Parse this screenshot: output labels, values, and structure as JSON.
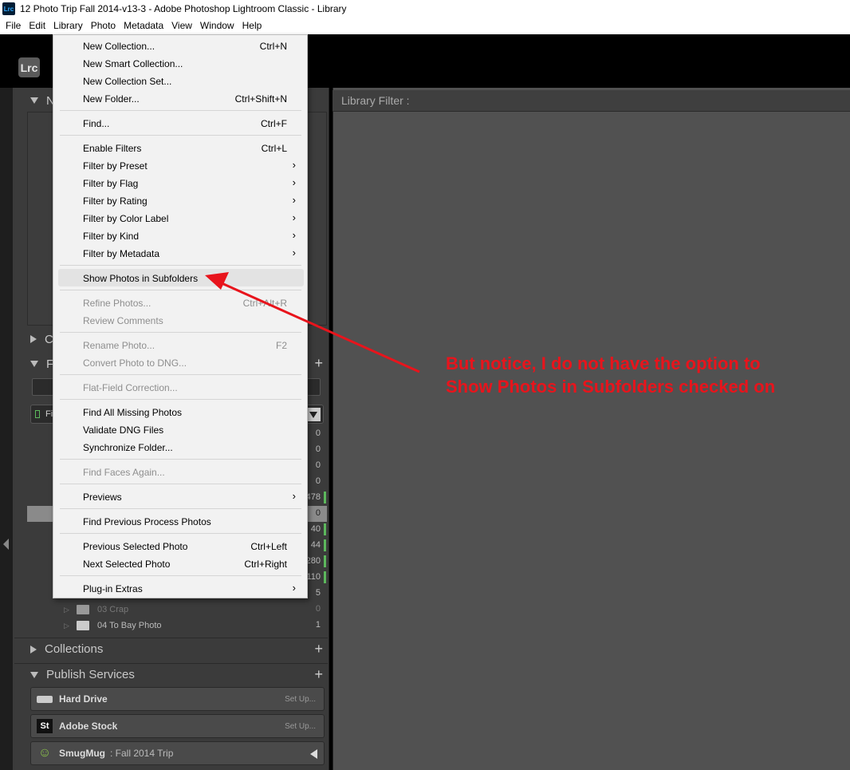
{
  "window": {
    "title": "12 Photo Trip Fall 2014-v13-3 - Adobe Photoshop Lightroom Classic - Library",
    "app_icon": "Lrc"
  },
  "menubar": [
    "File",
    "Edit",
    "Library",
    "Photo",
    "Metadata",
    "View",
    "Window",
    "Help"
  ],
  "logo": "Lrc",
  "left_panel": {
    "navigator_initial": "N",
    "collapsed_initial_c": "C",
    "folders_initial": "F",
    "volume_initial": "Fi",
    "folder_counts": [
      "0",
      "0",
      "0",
      "0",
      "478",
      "0",
      "40",
      "44",
      "280",
      "110",
      "5"
    ],
    "folder_rows": [
      {
        "name": "03 Crap",
        "count": "0",
        "dim": true
      },
      {
        "name": "04 To Bay Photo",
        "count": "1",
        "dim": false
      }
    ],
    "collections_label": "Collections",
    "publish_label": "Publish Services",
    "publish_services": [
      {
        "name": "Hard Drive",
        "sub": "",
        "action": "Set Up...",
        "icon": "hard-drive-icon"
      },
      {
        "name": "Adobe Stock",
        "sub": "",
        "action": "Set Up...",
        "icon": "adobe-stock-icon",
        "icon_text": "St"
      },
      {
        "name": "SmugMug",
        "sub": ":  Fall 2014 Trip",
        "action": "",
        "icon": "smugmug-icon"
      }
    ]
  },
  "library_filter": "Library Filter :",
  "library_menu": {
    "items": [
      {
        "label": "New Collection...",
        "shortcut": "Ctrl+N"
      },
      {
        "label": "New Smart Collection...",
        "shortcut": ""
      },
      {
        "label": "New Collection Set...",
        "shortcut": ""
      },
      {
        "label": "New Folder...",
        "shortcut": "Ctrl+Shift+N"
      },
      {
        "label": "Find...",
        "shortcut": "Ctrl+F"
      },
      {
        "label": "Enable Filters",
        "shortcut": "Ctrl+L"
      },
      {
        "label": "Filter by Preset",
        "shortcut": ""
      },
      {
        "label": "Filter by Flag",
        "shortcut": ""
      },
      {
        "label": "Filter by Rating",
        "shortcut": ""
      },
      {
        "label": "Filter by Color Label",
        "shortcut": ""
      },
      {
        "label": "Filter by Kind",
        "shortcut": ""
      },
      {
        "label": "Filter by Metadata",
        "shortcut": ""
      },
      {
        "label": "Show Photos in Subfolders",
        "shortcut": ""
      },
      {
        "label": "Refine Photos...",
        "shortcut": "Ctrl+Alt+R"
      },
      {
        "label": "Review Comments",
        "shortcut": ""
      },
      {
        "label": "Rename Photo...",
        "shortcut": "F2"
      },
      {
        "label": "Convert Photo to DNG...",
        "shortcut": ""
      },
      {
        "label": "Flat-Field Correction...",
        "shortcut": ""
      },
      {
        "label": "Find All Missing Photos",
        "shortcut": ""
      },
      {
        "label": "Validate DNG Files",
        "shortcut": ""
      },
      {
        "label": "Synchronize Folder...",
        "shortcut": ""
      },
      {
        "label": "Find Faces Again...",
        "shortcut": ""
      },
      {
        "label": "Previews",
        "shortcut": ""
      },
      {
        "label": "Find Previous Process Photos",
        "shortcut": ""
      },
      {
        "label": "Previous Selected Photo",
        "shortcut": "Ctrl+Left"
      },
      {
        "label": "Next Selected Photo",
        "shortcut": "Ctrl+Right"
      },
      {
        "label": "Plug-in Extras",
        "shortcut": ""
      }
    ],
    "submenu_glyph": "›"
  },
  "annotation": {
    "line1": "But notice, I do not have the option to",
    "line2": "Show Photos in Subfolders checked on",
    "color": "#e8141c"
  }
}
